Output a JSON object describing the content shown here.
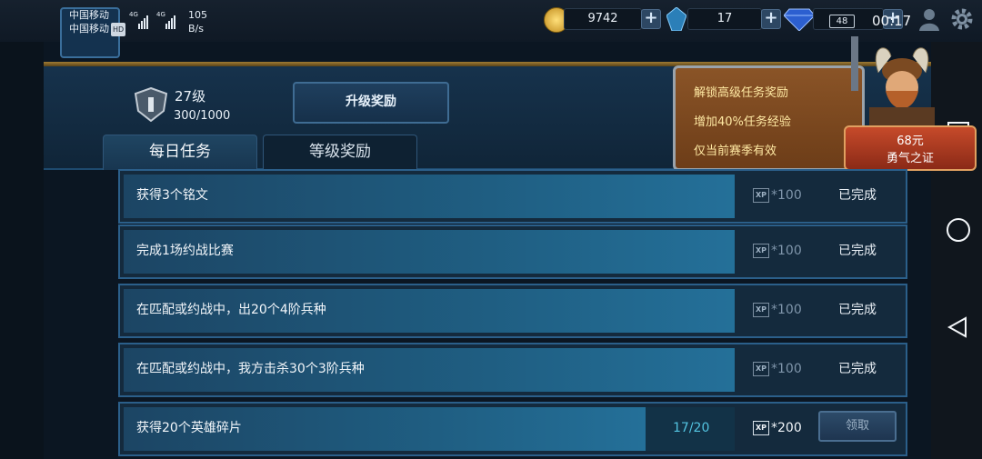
{
  "status_bar": {
    "carrier1": "中国移动",
    "carrier2": "中国移动",
    "hd_badge": "HD",
    "net1": "4G",
    "net2": "4G",
    "speed_value": "105",
    "speed_unit": "B/s",
    "battery": "48",
    "time": "00:17"
  },
  "resources": {
    "gold": "9742",
    "crystal": "17"
  },
  "level": {
    "level_label": "27级",
    "xp_progress": "300/1000",
    "progress_fraction": 0.3
  },
  "upgrade_button": "升级奖励",
  "tabs": [
    {
      "label": "每日任务",
      "active": true
    },
    {
      "label": "等级奖励",
      "active": false
    }
  ],
  "promo": {
    "perks": [
      "解锁高级任务奖励",
      "增加40%任务经验",
      "仅当前赛季有效"
    ],
    "price": "68元",
    "item_name": "勇气之证"
  },
  "tasks": [
    {
      "title": "获得3个铭文",
      "xp_icon": "XP",
      "xp": "*100",
      "status": "已完成",
      "fill": 1.0
    },
    {
      "title": "完成1场约战比赛",
      "xp_icon": "XP",
      "xp": "*100",
      "status": "已完成",
      "fill": 1.0
    },
    {
      "title": "在匹配或约战中，出20个4阶兵种",
      "xp_icon": "XP",
      "xp": "*100",
      "status": "已完成",
      "fill": 1.0
    },
    {
      "title": "在匹配或约战中，我方击杀30个3阶兵种",
      "xp_icon": "XP",
      "xp": "*100",
      "status": "已完成",
      "fill": 1.0
    },
    {
      "title": "获得20个英雄碎片",
      "progress": "17/20",
      "xp_icon": "XP",
      "xp": "*200",
      "claim_label": "领取",
      "fill": 0.85
    }
  ],
  "colors": {
    "accent_blue": "#2b5f8a",
    "progress_text": "#53c3e0",
    "gold": "#a07c34",
    "price_red": "#c64a2a"
  },
  "icons": [
    "gold-coin-icon",
    "crystal-icon",
    "diamond-icon",
    "profile-icon",
    "settings-icon",
    "level-shield-icon",
    "back-nav-icon",
    "home-nav-icon",
    "recents-nav-icon"
  ]
}
